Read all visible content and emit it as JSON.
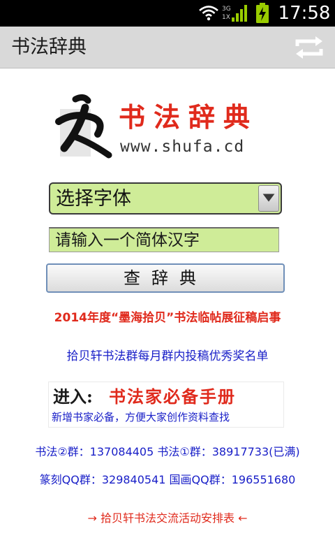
{
  "status_bar": {
    "time": "17:58",
    "network_label": "3G",
    "network_sublabel": "1X",
    "icons": [
      "wifi-icon",
      "signal-icon",
      "battery-icon"
    ]
  },
  "action_bar": {
    "title": "书法辞典",
    "refresh_icon": "refresh-icon"
  },
  "logo": {
    "brand": "书法辞典",
    "url": "www.shufa.cd"
  },
  "form": {
    "font_select": "选择字体",
    "char_input_placeholder": "请输入一个简体汉字",
    "search_button": "查辞典"
  },
  "links": {
    "notice_red": "2014年度“墨海拾贝”书法临帖展征稿启事",
    "notice_blue": "拾贝轩书法群每月群内投稿优秀奖名单",
    "schedule": "→ 拾贝轩书法交流活动安排表 ←"
  },
  "handbook": {
    "enter_label": "进入:",
    "title": "书法家必备手册",
    "tagline": "新增书家必备，方便大家创作资料查找"
  },
  "qq_groups": {
    "line1": "书法②群：137084405  书法①群：38917733(已满)",
    "line2": "篆刻QQ群：329840541  国画QQ群：196551680"
  },
  "colors": {
    "accent_red": "#e02a1c",
    "link_blue": "#1a20c8",
    "input_green": "#cfec98",
    "action_bar_gray": "#d9d9d9"
  }
}
